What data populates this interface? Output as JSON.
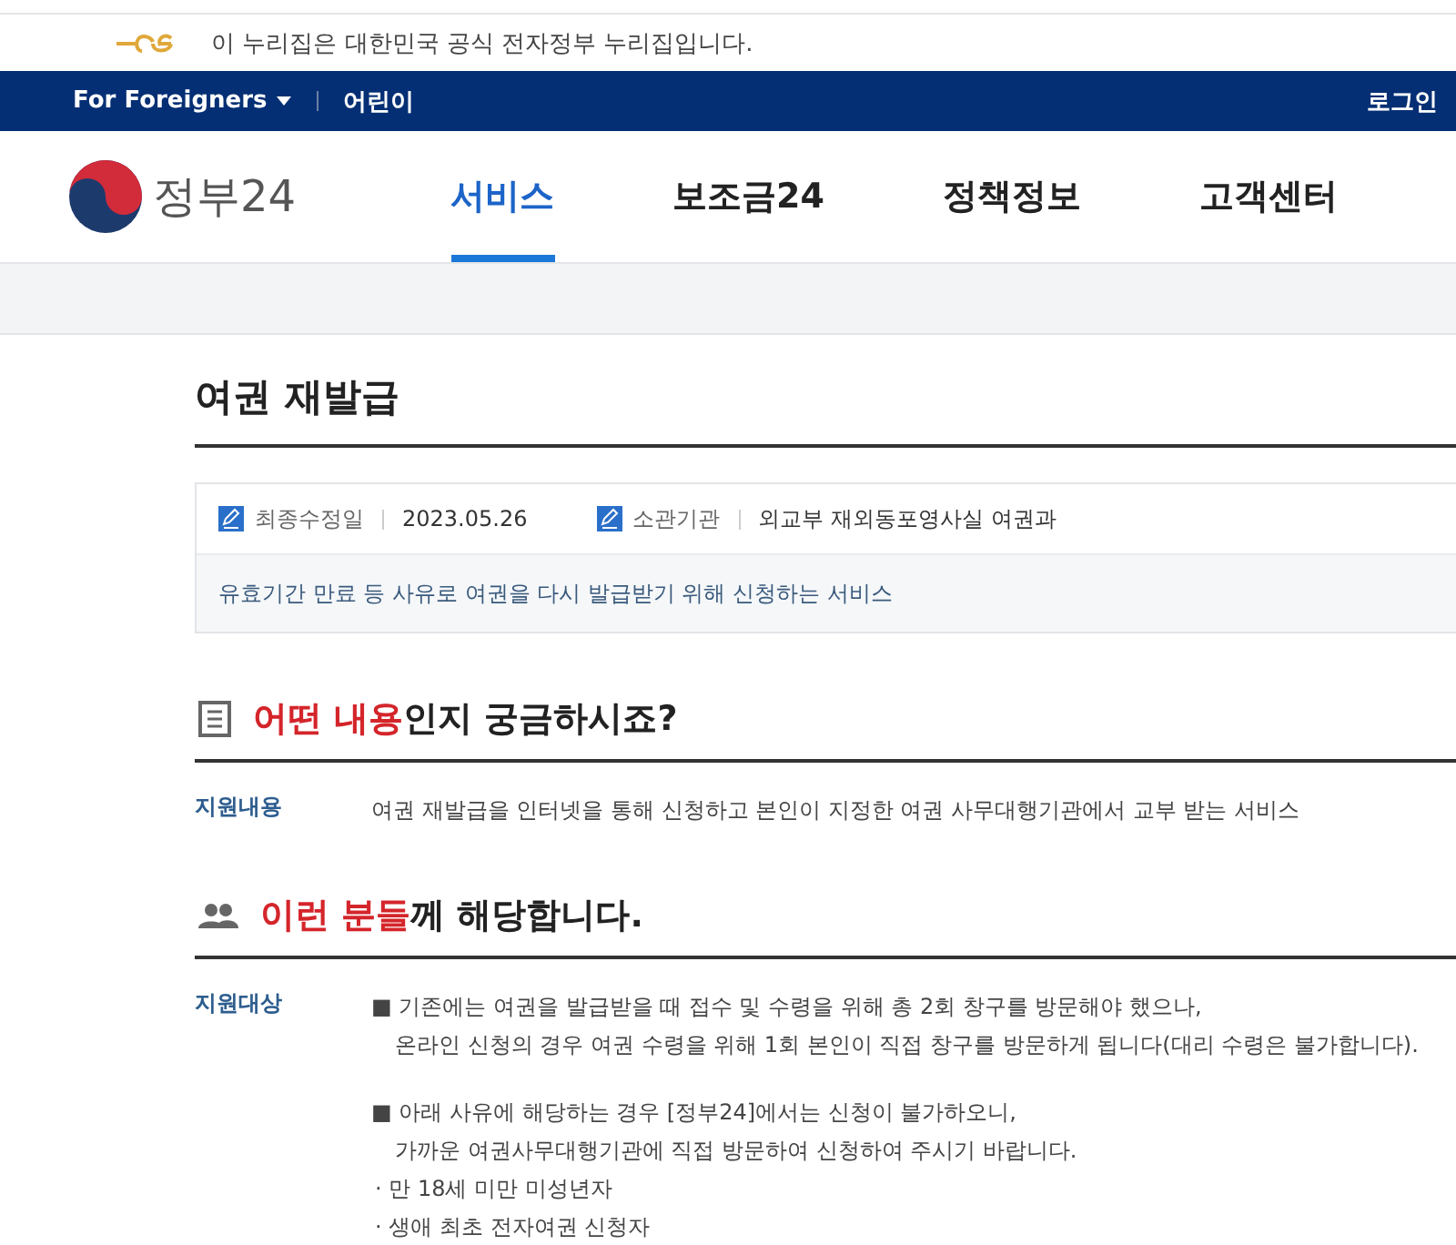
{
  "gov_banner": {
    "text": "이 누리집은 대한민국 공식 전자정부 누리집입니다."
  },
  "top_bar": {
    "links": [
      {
        "label": "For Foreigners",
        "kind": "dropdown"
      },
      {
        "label": "어린이",
        "kind": "link"
      }
    ],
    "login": "로그인"
  },
  "header": {
    "logo_text": "정부24",
    "nav": [
      {
        "label": "서비스",
        "selected": true
      },
      {
        "label": "보조금24",
        "selected": false
      },
      {
        "label": "정책정보",
        "selected": false
      },
      {
        "label": "고객센터",
        "selected": false
      }
    ]
  },
  "page": {
    "title": "여권 재발급",
    "meta": [
      {
        "label": "최종수정일",
        "value": "2023.05.26"
      },
      {
        "label": "소관기관",
        "value": "외교부 재외동포영사실 여권과"
      }
    ],
    "summary": "유효기간 만료 등 사유로 여권을 다시 발급받기 위해 신청하는 서비스"
  },
  "sections": [
    {
      "kind": "document",
      "heading_highlight": "어떤 내용",
      "heading_rest": "인지 궁금하시죠?",
      "rows": [
        {
          "label": "지원내용",
          "blocks": [
            [
              {
                "kind": "plain",
                "text": "여권 재발급을 인터넷을 통해 신청하고 본인이 지정한 여권 사무대행기관에서 교부 받는 서비스"
              }
            ]
          ]
        }
      ]
    },
    {
      "kind": "people",
      "heading_highlight": "이런 분들",
      "heading_rest": "께 해당합니다.",
      "rows": [
        {
          "label": "지원대상",
          "blocks": [
            [
              {
                "kind": "bullet",
                "text": "■ 기존에는 여권을 발급받을 때 접수 및 수령을 위해 총 2회 창구를 방문해야 했으나,"
              },
              {
                "kind": "cont",
                "text": "온라인 신청의 경우 여권 수령을 위해 1회 본인이 직접 창구를 방문하게 됩니다(대리 수령은 불가합니다)."
              }
            ],
            [
              {
                "kind": "bullet",
                "text": "■ 아래 사유에 해당하는 경우 [정부24]에서는 신청이 불가하오니,"
              },
              {
                "kind": "cont",
                "text": "가까운 여권사무대행기관에 직접 방문하여 신청하여 주시기 바랍니다."
              },
              {
                "kind": "dot",
                "text": "· 만 18세 미만 미성년자"
              },
              {
                "kind": "dot",
                "text": "· 생애 최초 전자여권 신청자"
              }
            ]
          ]
        }
      ]
    }
  ]
}
